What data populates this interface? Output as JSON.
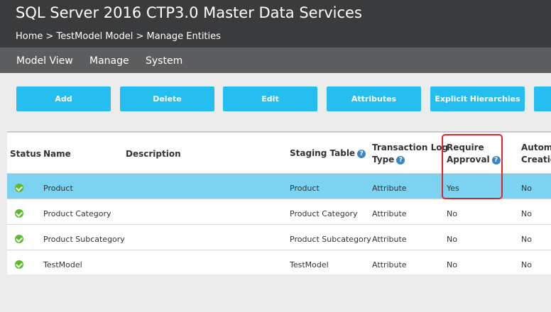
{
  "header": {
    "title": "SQL Server 2016 CTP3.0 Master Data Services",
    "breadcrumb": "Home > TestModel Model > Manage Entities"
  },
  "menu": {
    "items": [
      {
        "label": "Model View"
      },
      {
        "label": "Manage"
      },
      {
        "label": "System"
      }
    ]
  },
  "toolbar": {
    "buttons": [
      {
        "label": "Add"
      },
      {
        "label": "Delete"
      },
      {
        "label": "Edit"
      },
      {
        "label": "Attributes"
      },
      {
        "label": "Explicit Hierarchies"
      }
    ]
  },
  "grid": {
    "columns": {
      "status": "Status",
      "name": "Name",
      "description": "Description",
      "staging": "Staging Table",
      "txn_line1": "Transaction Log",
      "txn_line2": "Type",
      "approval_line1": "Require",
      "approval_line2": "Approval",
      "auto_line1": "Automa",
      "auto_line2": "Creatio"
    },
    "rows": [
      {
        "name": "Product",
        "description": "",
        "staging": "Product",
        "txn": "Attribute",
        "approval": "Yes",
        "auto": "No",
        "selected": true
      },
      {
        "name": "Product Category",
        "description": "",
        "staging": "Product Category",
        "txn": "Attribute",
        "approval": "No",
        "auto": "No"
      },
      {
        "name": "Product Subcategory",
        "description": "",
        "staging": "Product Subcategory",
        "txn": "Attribute",
        "approval": "No",
        "auto": "No"
      },
      {
        "name": "TestModel",
        "description": "",
        "staging": "TestModel",
        "txn": "Attribute",
        "approval": "No",
        "auto": "No"
      }
    ]
  },
  "colors": {
    "accent": "#26bdf0",
    "selected_row": "#7bd2f1",
    "status_ok": "#5fb832",
    "highlight": "#e0242a"
  }
}
